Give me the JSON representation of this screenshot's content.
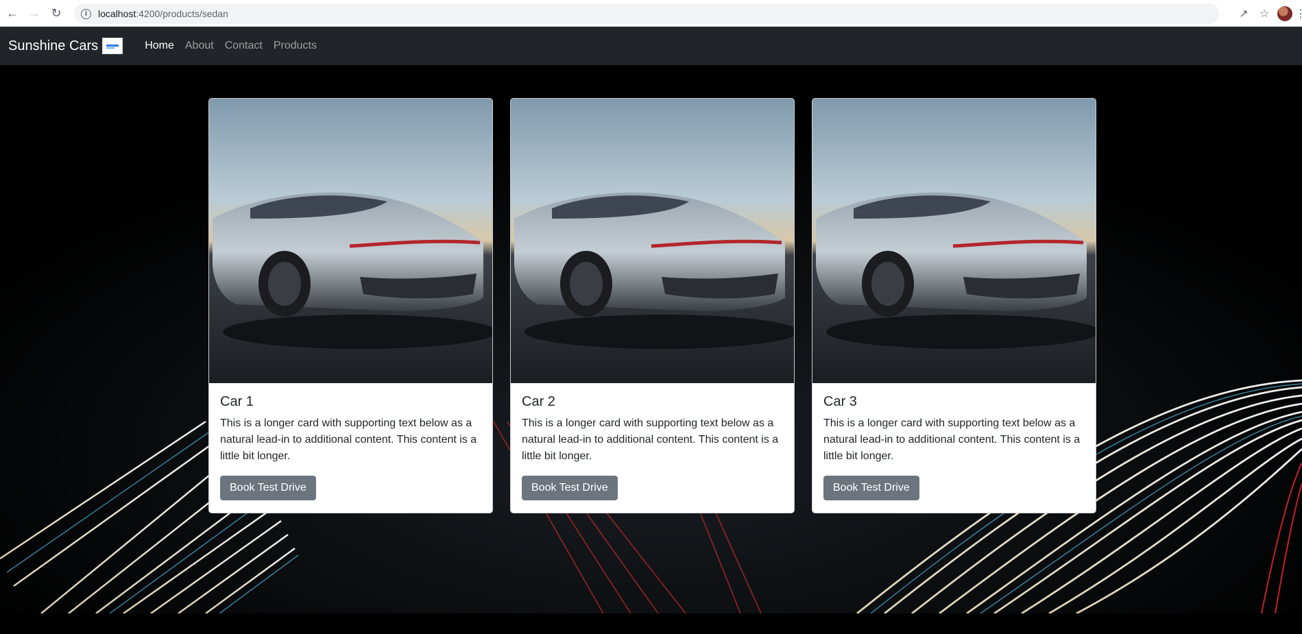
{
  "browser": {
    "url_host": "localhost",
    "url_rest": ":4200/products/sedan",
    "icons": [
      "back-arrow-icon",
      "forward-arrow-icon",
      "reload-icon",
      "info-icon",
      "share-icon",
      "star-icon",
      "avatar",
      "menu-dots-icon"
    ]
  },
  "navbar": {
    "brand": "Sunshine Cars",
    "links": [
      {
        "label": "Home",
        "active": true
      },
      {
        "label": "About",
        "active": false
      },
      {
        "label": "Contact",
        "active": false
      },
      {
        "label": "Products",
        "active": false
      }
    ],
    "bg_color": "#212529"
  },
  "cards": [
    {
      "title": "Car 1",
      "text": "This is a longer card with supporting text below as a natural lead-in to additional content. This content is a little bit longer.",
      "button": "Book Test Drive"
    },
    {
      "title": "Car 2",
      "text": "This is a longer card with supporting text below as a natural lead-in to additional content. This content is a little bit longer.",
      "button": "Book Test Drive"
    },
    {
      "title": "Car 3",
      "text": "This is a longer card with supporting text below as a natural lead-in to additional content. This content is a little bit longer.",
      "button": "Book Test Drive"
    }
  ],
  "colors": {
    "button": "#6c757d",
    "background": "#000000"
  }
}
